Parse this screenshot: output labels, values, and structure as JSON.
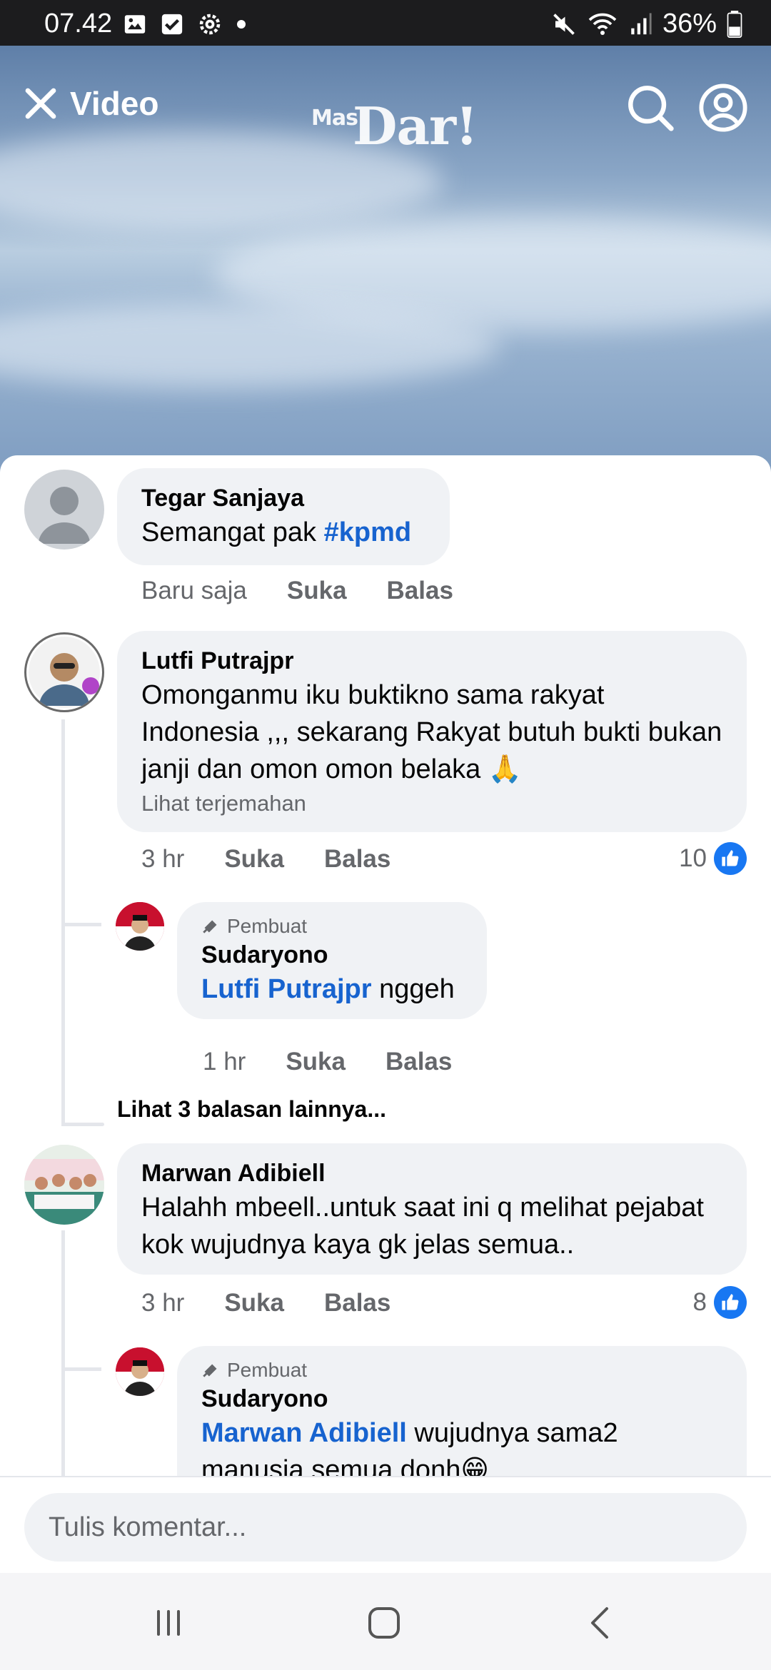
{
  "status_bar": {
    "time": "07.42",
    "battery": "36%",
    "icons": [
      "image-icon",
      "checkbox-icon",
      "settings-icon",
      "dot-icon",
      "mute-icon",
      "wifi-icon",
      "signal-icon",
      "battery-icon"
    ]
  },
  "header": {
    "close_label": "Video",
    "logo_small": "Mas",
    "logo_main": "Dar!"
  },
  "comments": [
    {
      "author": "Tegar Sanjaya",
      "text_plain": "Semangat pak ",
      "hashtag": "#kpmd",
      "time": "Baru saja",
      "like": "Suka",
      "reply": "Balas"
    },
    {
      "author": "Lutfi Putrajpr",
      "text": "Omonganmu iku buktikno sama rakyat Indonesia ,,, sekarang Rakyat butuh bukti bukan janji dan omon omon belaka 🙏",
      "translate": "Lihat terjemahan",
      "time": "3 hr",
      "like": "Suka",
      "reply": "Balas",
      "like_count": "10",
      "replies": [
        {
          "badge": "Pembuat",
          "author": "Sudaryono",
          "mention": "Lutfi Putrajpr",
          "text": " nggeh",
          "time": "1 hr",
          "like": "Suka",
          "reply": "Balas"
        }
      ],
      "more_replies": "Lihat 3 balasan lainnya..."
    },
    {
      "author": "Marwan Adibiell",
      "text": "Halahh mbeell..untuk saat ini q melihat pejabat kok wujudnya kaya gk jelas semua..",
      "time": "3 hr",
      "like": "Suka",
      "reply": "Balas",
      "like_count": "8",
      "replies": [
        {
          "badge": "Pembuat",
          "author": "Sudaryono",
          "mention": "Marwan Adibiell",
          "text": " wujudnya sama2 manusia semua donh😁"
        }
      ]
    }
  ],
  "composer": {
    "placeholder": "Tulis komentar..."
  },
  "colors": {
    "accent": "#1877f2",
    "mention": "#1763cf",
    "bubble": "#f0f2f5",
    "secondary_text": "#65676b"
  }
}
